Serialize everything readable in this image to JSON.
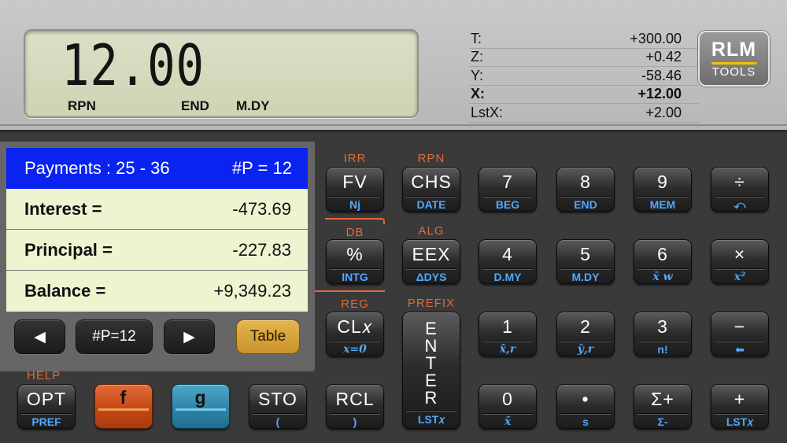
{
  "display": {
    "value": "12.00",
    "annunciators": [
      "RPN",
      "END",
      "M.DY"
    ]
  },
  "stack": [
    {
      "label": "T:",
      "value": "+300.00"
    },
    {
      "label": "Z:",
      "value": "+0.42"
    },
    {
      "label": "Y:",
      "value": "-58.46"
    },
    {
      "label": "X:",
      "value": "+12.00"
    },
    {
      "label": "LstX:",
      "value": "+2.00"
    }
  ],
  "logo": {
    "top": "RLM",
    "bottom": "TOOLS"
  },
  "amortization": {
    "header_left": "Payments : 25 - 36",
    "header_right": "#P = 12",
    "rows": [
      {
        "label": "Interest =",
        "value": "-473.69"
      },
      {
        "label": "Principal =",
        "value": "-227.83"
      },
      {
        "label": "Balance =",
        "value": "+9,349.23"
      }
    ]
  },
  "nav": {
    "prev": "◀",
    "count": "#P=12",
    "next": "▶",
    "table": "Table"
  },
  "function_labels": {
    "irr": "IRR",
    "rpn": "RPN",
    "db": "DB",
    "alg": "ALG",
    "reg": "REG",
    "prefix": "PREFIX",
    "help": "HELP"
  },
  "keys": {
    "fv": {
      "main": "FV",
      "low": "Nj"
    },
    "chs": {
      "main": "CHS",
      "low": "DATE"
    },
    "k7": {
      "main": "7",
      "low": "BEG"
    },
    "k8": {
      "main": "8",
      "low": "END"
    },
    "k9": {
      "main": "9",
      "low": "MEM"
    },
    "div": {
      "main": "÷",
      "low": "⤺"
    },
    "pct": {
      "main": "%",
      "low": "INTG"
    },
    "eex": {
      "main": "EEX",
      "low": "ΔDYS"
    },
    "k4": {
      "main": "4",
      "low": "D.MY"
    },
    "k5": {
      "main": "5",
      "low": "M.DY"
    },
    "k6": {
      "main": "6",
      "low": "x̄ w"
    },
    "mul": {
      "main": "×",
      "low": "x²"
    },
    "clx": {
      "main": "CL𝑥",
      "low": "x=0"
    },
    "enter": {
      "main": "ENTER",
      "low": "LST𝑥"
    },
    "k1": {
      "main": "1",
      "low": "x̂,r"
    },
    "k2": {
      "main": "2",
      "low": "ŷ,r"
    },
    "k3": {
      "main": "3",
      "low": "n!"
    },
    "sub": {
      "main": "−",
      "low": "⬅"
    },
    "opt": {
      "main": "OPT",
      "low": "PREF"
    },
    "f": {
      "main": "f"
    },
    "g": {
      "main": "g"
    },
    "sto": {
      "main": "STO",
      "low": "("
    },
    "rcl": {
      "main": "RCL",
      "low": ")"
    },
    "k0": {
      "main": "0",
      "low": "x̄"
    },
    "dot": {
      "main": "•",
      "low": "s"
    },
    "sigp": {
      "main": "Σ+",
      "low": "Σ-"
    },
    "add": {
      "main": "+",
      "low": "LST𝑥"
    }
  }
}
